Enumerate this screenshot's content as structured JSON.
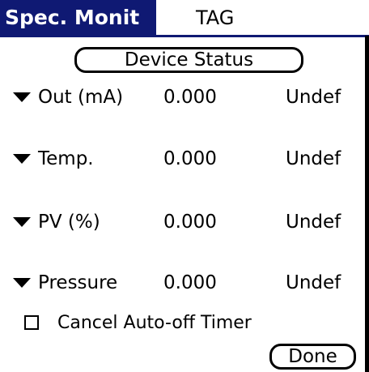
{
  "title": {
    "tab_label": "Spec. Monit",
    "tag_label": "TAG"
  },
  "buttons": {
    "device_status": "Device Status",
    "done": "Done"
  },
  "colors": {
    "title_background": "#0f1973",
    "title_text": "#ffffff",
    "text": "#000000",
    "background": "#ffffff"
  },
  "icons": {
    "row_dropdown": "dropdown-arrow-icon",
    "checkbox": "checkbox-unchecked-icon"
  },
  "rows": [
    {
      "label": "Out (mA)",
      "value": "0.000",
      "status": "Undef"
    },
    {
      "label": "Temp.",
      "value": "0.000",
      "status": "Undef"
    },
    {
      "label": "PV (%)",
      "value": "0.000",
      "status": "Undef"
    },
    {
      "label": "Pressure",
      "value": "0.000",
      "status": "Undef"
    }
  ],
  "checkbox": {
    "label": "Cancel Auto-off Timer",
    "checked": false
  }
}
